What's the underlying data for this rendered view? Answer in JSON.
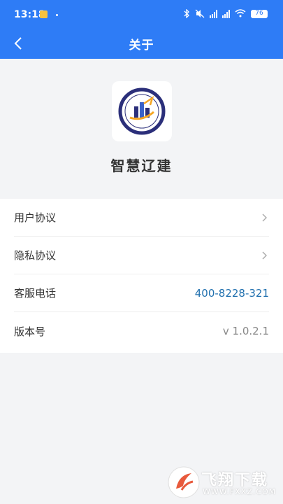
{
  "status_bar": {
    "time": "13:18",
    "battery": "76",
    "icons": [
      "bluetooth-icon",
      "mute-icon",
      "hd-signal-icon",
      "hd-signal-icon",
      "wifi-icon",
      "battery-icon"
    ]
  },
  "nav": {
    "title": "关于",
    "back_icon": "chevron-left-icon"
  },
  "app": {
    "name": "智慧辽建",
    "logo": "app-logo-icon"
  },
  "list": {
    "items": [
      {
        "label": "用户协议",
        "value": "",
        "chevron": true
      },
      {
        "label": "隐私协议",
        "value": "",
        "chevron": true
      },
      {
        "label": "客服电话",
        "value": "400-8228-321",
        "value_color": "#1f6fae",
        "chevron": false
      },
      {
        "label": "版本号",
        "value": "v 1.0.2.1",
        "value_color": "#888888",
        "chevron": false
      }
    ]
  },
  "watermark": {
    "cn": "飞翔下载",
    "en": "WWW.FXXZ.COM"
  },
  "colors": {
    "primary": "#2e7cf6",
    "background": "#f3f4f6",
    "link": "#1f6fae"
  }
}
